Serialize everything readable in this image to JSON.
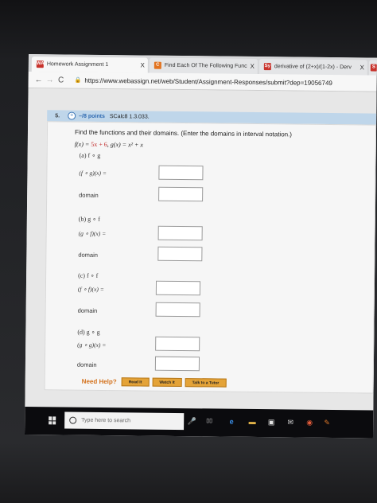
{
  "browser": {
    "tabs": [
      {
        "label": "Homework Assignment 1",
        "favicon": "WA",
        "active": true
      },
      {
        "label": "Find Each Of The Following Func",
        "favicon": "C",
        "active": false
      },
      {
        "label": "derivative of (2+x)/(1-2x) - Derv",
        "favicon": "Sy",
        "active": false
      },
      {
        "label": "S",
        "favicon": "S",
        "active": false
      }
    ],
    "close_glyph": "X",
    "back_glyph": "←",
    "forward_glyph": "→",
    "reload_glyph": "C",
    "lock_glyph": "🔒",
    "url": "https://www.webassign.net/web/Student/Assignment-Responses/submit?dep=19056749"
  },
  "question": {
    "number": "5.",
    "plus": "+",
    "points": "–/8 points",
    "code": "SCalc8 1.3.033.",
    "instructions": "Find the functions and their domains. (Enter the domains in interval notation.)",
    "f_def": "f(x) = ",
    "f_expr": "5x + 6",
    "g_def": ",   g(x) = x² + x",
    "parts": [
      {
        "label": "(a)   f ∘ g",
        "comp": "(f ∘ g)(x) =",
        "domain": "domain"
      },
      {
        "label": "(b)   g ∘ f",
        "comp": "(g ∘ f)(x) =",
        "domain": "domain"
      },
      {
        "label": "(c)   f ∘ f",
        "comp": "(f ∘ f)(x) =",
        "domain": "domain"
      },
      {
        "label": "(d)   g ∘ g",
        "comp": "(g ∘ g)(x) =",
        "domain": "domain"
      }
    ],
    "help": {
      "label": "Need Help?",
      "read": "Read It",
      "watch": "Watch It",
      "tutor": "Talk to a Tutor"
    }
  },
  "taskbar": {
    "search_placeholder": "Type here to search",
    "mic_glyph": "🎤",
    "taskview_glyph": "▯▯",
    "edge_glyph": "e",
    "folder_glyph": "▬",
    "store_glyph": "▣",
    "mail_glyph": "✉",
    "chrome_glyph": "◉",
    "paint_glyph": "✎"
  },
  "colors": {
    "question_header": "#bfd6ea",
    "points_blue": "#2e69b0",
    "help_orange": "#d4721d",
    "help_button": "#e4a338",
    "red_expr": "#c12c2c"
  }
}
